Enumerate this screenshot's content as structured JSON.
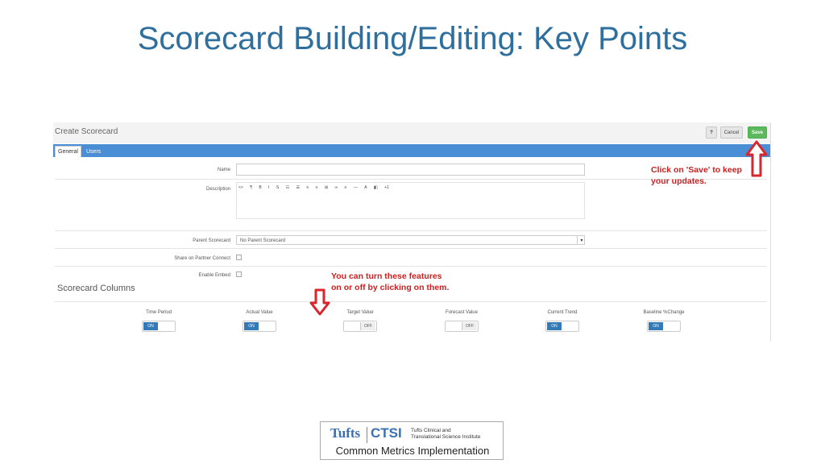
{
  "slide": {
    "title": "Scorecard Building/Editing: Key Points"
  },
  "app": {
    "window_title": "Create Scorecard",
    "buttons": {
      "help_icon": "?",
      "cancel": "Cancel",
      "save": "Save"
    },
    "tabs": [
      {
        "label": "General",
        "active": true
      },
      {
        "label": "Users",
        "active": false
      }
    ],
    "form": {
      "name_label": "Name",
      "name_value": "",
      "description_label": "Description",
      "editor_tools": [
        "<>",
        "¶",
        "B",
        "I",
        "S",
        "☷",
        "☰",
        "≡",
        "≡",
        "⊞",
        "∞",
        "≡",
        "—",
        "A",
        "◧",
        "+1"
      ],
      "parent_label": "Parent Scorecard",
      "parent_value": "No Parent Scorecard",
      "share_label": "Share on Partner Connect",
      "embed_label": "Enable Embed"
    },
    "columns_section": {
      "title": "Scorecard Columns",
      "columns": [
        {
          "label": "Time Period",
          "state": "ON",
          "on": true
        },
        {
          "label": "Actual Value",
          "state": "ON",
          "on": true
        },
        {
          "label": "Target Value",
          "state": "OFF",
          "on": false
        },
        {
          "label": "Forecast Value",
          "state": "OFF",
          "on": false
        },
        {
          "label": "Current Trend",
          "state": "ON",
          "on": true
        },
        {
          "label": "Baseline %Change",
          "state": "ON",
          "on": true
        }
      ]
    }
  },
  "annotations": {
    "save_note_line1": "Click on 'Save' to keep",
    "save_note_line2": "your updates.",
    "toggle_note_line1": "You can turn these features",
    "toggle_note_line2": "on or off by clicking on them.",
    "arrow_color": "#d9262c"
  },
  "logo": {
    "tufts": "Tufts",
    "ctsi": "CTSI",
    "subtitle_line1": "Tufts Clinical and",
    "subtitle_line2": "Translational Science Institute",
    "tagline": "Common Metrics Implementation"
  },
  "colors": {
    "title": "#2e6f9e",
    "tabbar": "#4a8ed6",
    "save_button": "#5cb85c",
    "toggle_on": "#337ab7",
    "note_red": "#cc1f1f"
  }
}
